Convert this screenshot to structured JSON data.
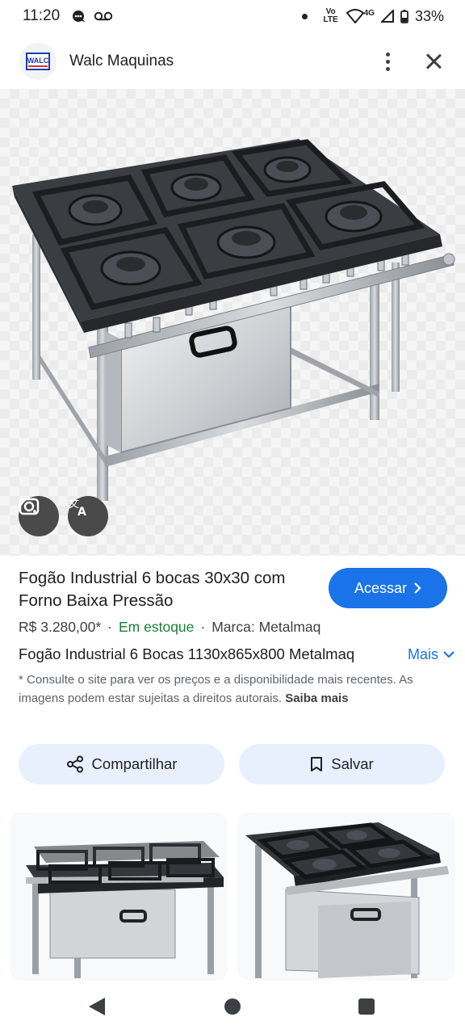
{
  "status_bar": {
    "time": "11:20",
    "network_label": "Vo LTE",
    "network_type": "4G",
    "battery": "33%"
  },
  "header": {
    "logo_text": "WALC",
    "site_name": "Walc Maquinas"
  },
  "product": {
    "title": "Fogão Industrial 6 bocas 30x30 com Forno Baixa Pressão",
    "visit_label": "Acessar",
    "price": "R$ 3.280,00*",
    "stock": "Em estoque",
    "brand": "Marca: Metalmaq",
    "description": "Fogão Industrial 6 Bocas 1130x865x800 Metalmaq",
    "more_label": "Mais",
    "notice": "* Consulte o site para ver os preços e a disponibilidade mais recentes. As imagens podem estar sujeitas a direitos autorais.",
    "learn_more": "Saiba mais"
  },
  "actions": {
    "share_label": "Compartilhar",
    "save_label": "Salvar"
  },
  "colors": {
    "accent": "#1a73e8",
    "stock_green": "#188038",
    "pill_bg": "#e8f0fe"
  }
}
